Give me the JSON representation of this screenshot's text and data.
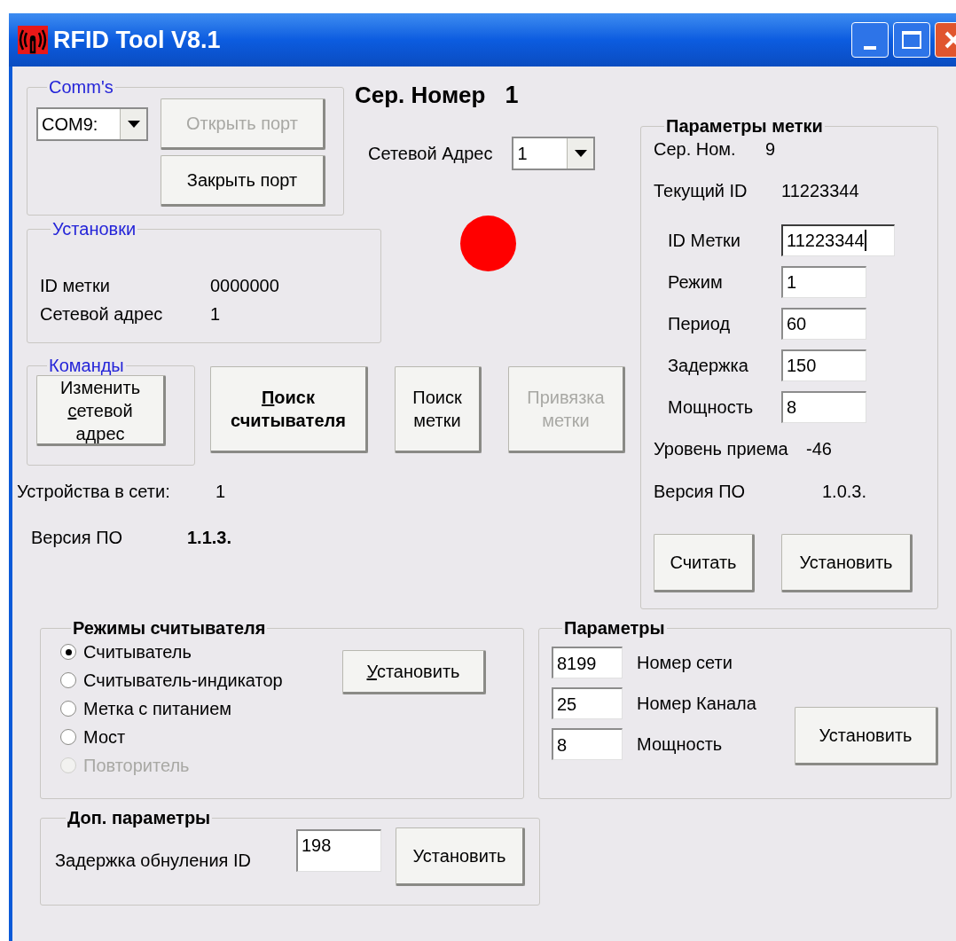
{
  "window": {
    "title": "RFID Tool V8.1"
  },
  "comms": {
    "title": "Comm's",
    "port": "COM9:",
    "buttons": [
      {
        "label": "Открыть порт",
        "disabled": true
      },
      {
        "label": "Закрыть порт",
        "disabled": false
      }
    ]
  },
  "serial": {
    "label": "Сер. Номер",
    "value": "1"
  },
  "network_address": {
    "label": "Сетевой Адрес",
    "value": "1"
  },
  "indicator": {
    "on": true
  },
  "settings": {
    "title": "Установки",
    "rows": [
      {
        "label": "ID метки",
        "value": "0000000"
      },
      {
        "label": "Сетевой адрес",
        "value": "1"
      }
    ]
  },
  "commands": {
    "title": "Команды",
    "buttons": [
      {
        "prefix": "Изменить ",
        "accel": "с",
        "label": "етевой адрес",
        "bold": false,
        "disabled": false
      }
    ]
  },
  "actions": [
    {
      "accel": "П",
      "label": "оиск считывателя",
      "bold": true,
      "disabled": false
    },
    {
      "label": "Поиск метки",
      "bold": false,
      "disabled": false
    },
    {
      "label": "Привязка метки",
      "bold": false,
      "disabled": true
    }
  ],
  "devices": {
    "label": "Устройства в сети:",
    "value": "1"
  },
  "firmware": {
    "label": "Версия ПО",
    "value": "1.1.3."
  },
  "tag_params": {
    "title": "Параметры метки",
    "info": [
      {
        "label": "Сер. Ном.",
        "value": "9"
      },
      {
        "label": "Текущий ID",
        "value": "11223344"
      }
    ],
    "fields": [
      {
        "label": "ID Метки",
        "value": "11223344",
        "focused": true
      },
      {
        "label": "Режим",
        "value": "1",
        "focused": false
      },
      {
        "label": "Период",
        "value": "60",
        "focused": false
      },
      {
        "label": "Задержка",
        "value": "150",
        "focused": false
      },
      {
        "label": "Мощность",
        "value": "8",
        "focused": false
      }
    ],
    "readings": [
      {
        "label": "Уровень приема",
        "value": "-46"
      },
      {
        "label": "Версия ПО",
        "value": "1.0.3."
      }
    ],
    "buttons": [
      {
        "label": "Считать"
      },
      {
        "label": "Установить"
      }
    ]
  },
  "reader_modes": {
    "title": "Режимы считывателя",
    "options": [
      {
        "label": "Считыватель",
        "selected": true,
        "disabled": false
      },
      {
        "label": "Считыватель-индикатор",
        "selected": false,
        "disabled": false
      },
      {
        "label": "Метка  с питанием",
        "selected": false,
        "disabled": false
      },
      {
        "label": "Мост",
        "selected": false,
        "disabled": false
      },
      {
        "label": "Повторитель",
        "selected": false,
        "disabled": true
      }
    ],
    "button": {
      "accel": "У",
      "label": "становить"
    }
  },
  "params": {
    "title": "Параметры",
    "fields": [
      {
        "value": "8199",
        "label": "Номер сети"
      },
      {
        "value": "25",
        "label": "Номер Канала"
      },
      {
        "value": "8",
        "label": "Мощность"
      }
    ],
    "button": {
      "label": "Установить"
    }
  },
  "extra": {
    "title": "Доп. параметры",
    "field": {
      "label": "Задержка обнуления ID",
      "value": "198"
    },
    "button": {
      "label": "Установить"
    }
  }
}
